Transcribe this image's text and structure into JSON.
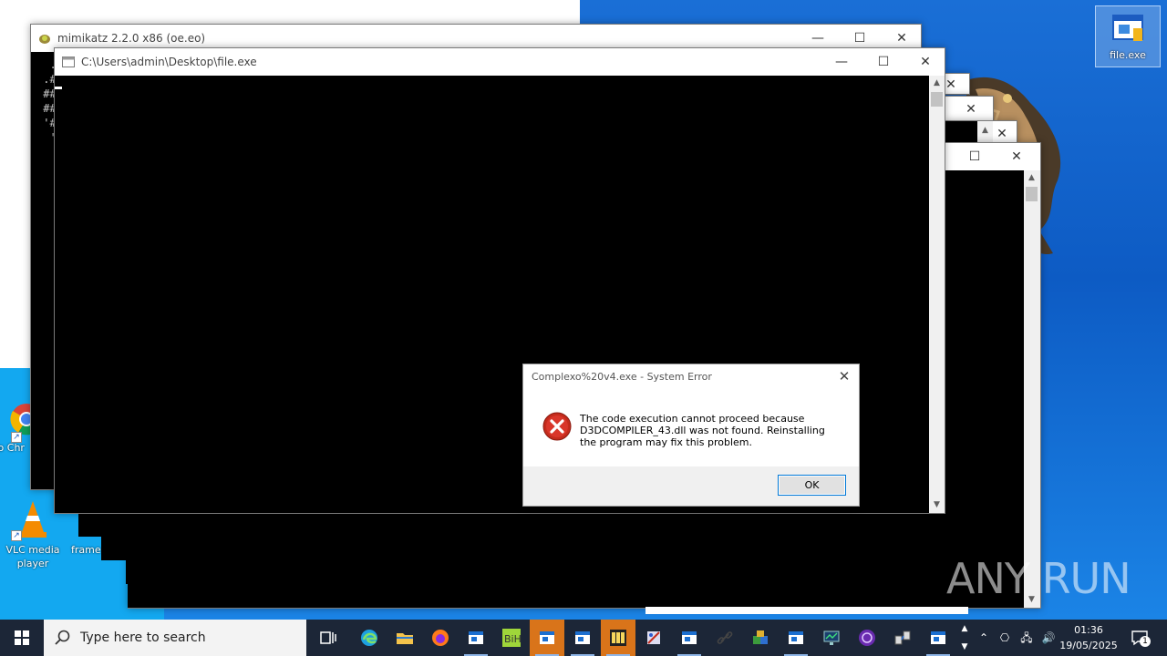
{
  "desktop": {
    "icons": [
      {
        "label": "file.exe",
        "selected": true
      },
      {
        "label": "Go Chr"
      },
      {
        "label": "VLC media player"
      },
      {
        "label": "frame"
      }
    ],
    "watermark": "ANY RUN"
  },
  "windows": {
    "mimikatz": {
      "title": "mimikatz 2.2.0 x86 (oe.eo)",
      "console_lines": [
        "  .",
        " .#",
        " ##",
        " ##",
        " '#",
        "  '"
      ]
    },
    "file_console": {
      "title": "C:\\Users\\admin\\Desktop\\file.exe"
    }
  },
  "dialog": {
    "title": "Complexo%20v4.exe - System Error",
    "message": "The code execution cannot proceed because D3DCOMPILER_43.dll was not found. Reinstalling the program may fix this problem.",
    "ok_label": "OK"
  },
  "taskbar": {
    "search_placeholder": "Type here to search",
    "apps": [
      "task-view",
      "edge",
      "file-explorer",
      "firefox",
      "window",
      "bih",
      "window",
      "window",
      "puzzle",
      "tool",
      "window",
      "link",
      "box",
      "window",
      "monitor",
      "purple",
      "network",
      "window"
    ],
    "clock": {
      "time": "01:36",
      "date": "19/05/2025"
    },
    "notification_count": "1"
  },
  "colors": {
    "accent": "#0078d7",
    "taskbar": "#1c2637",
    "error_red": "#c42b1c"
  }
}
